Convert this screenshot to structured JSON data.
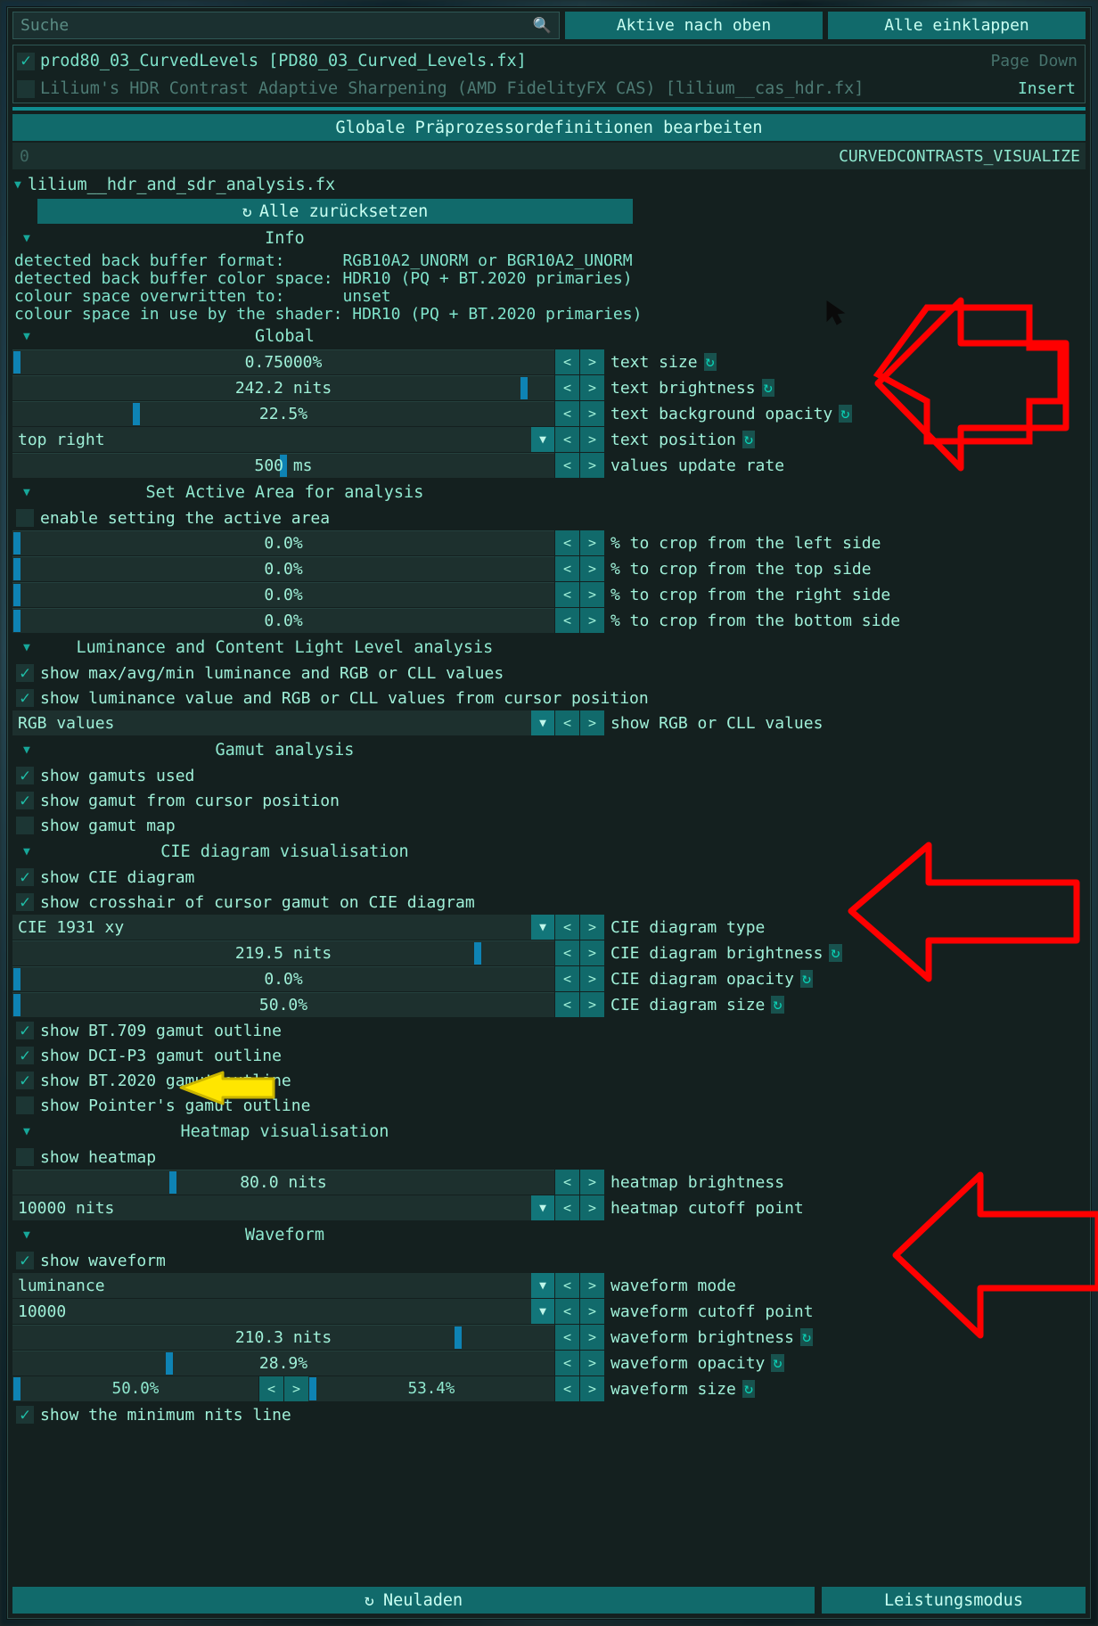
{
  "search": {
    "placeholder": "Suche",
    "icon": "search-icon"
  },
  "toolbar": {
    "active_top_label": "Aktive nach oben",
    "collapse_all_label": "Alle einklappen"
  },
  "techniques": [
    {
      "label": "prod80_03_CurvedLevels [PD80_03_Curved_Levels.fx]",
      "checked": true,
      "hint": "Page Down"
    },
    {
      "label": "Lilium's HDR Contrast Adaptive Sharpening (AMD FidelityFX CAS) [lilium__cas_hdr.fx]",
      "checked": false,
      "hint": "Insert"
    }
  ],
  "global_preproc": {
    "button_label": "Globale Präprozessordefinitionen bearbeiten",
    "value": "0",
    "name": "CURVEDCONTRASTS_VISUALIZE"
  },
  "effect": {
    "name": "lilium__hdr_and_sdr_analysis.fx",
    "reset_all_label": "Alle zurücksetzen"
  },
  "sections": {
    "info": "Info",
    "global": "Global",
    "active_area": "Set Active Area for analysis",
    "luminance": "Luminance and Content Light Level analysis",
    "gamut": "Gamut analysis",
    "cie": "CIE diagram visualisation",
    "heatmap": "Heatmap visualisation",
    "waveform": "Waveform"
  },
  "info_lines": [
    "detected back buffer format:      RGB10A2_UNORM or BGR10A2_UNORM",
    "detected back buffer color space: HDR10 (PQ + BT.2020 primaries)",
    "colour space overwritten to:      unset",
    "colour space in use by the shader: HDR10 (PQ + BT.2020 primaries)"
  ],
  "controls": {
    "text_size": {
      "value": "0.75000%",
      "label": "text size",
      "fill": 0.4,
      "reset": true
    },
    "text_brightness": {
      "value": "242.2 nits",
      "label": "text brightness",
      "fill": 94.5,
      "reset": true
    },
    "text_background_opacity": {
      "value": "22.5%",
      "label": "text background opacity",
      "fill": 22.5,
      "reset": true
    },
    "text_position": {
      "value": "top right",
      "label": "text position",
      "reset": true
    },
    "values_update_rate": {
      "value": "500 ms",
      "label": "values update rate",
      "fill": 49.0,
      "reset": false
    },
    "enable_active_area": {
      "label": "enable setting the active area",
      "checked": false
    },
    "crop_left": {
      "value": "0.0%",
      "label": "% to crop from the left side",
      "fill": 0
    },
    "crop_top": {
      "value": "0.0%",
      "label": "% to crop from the top side",
      "fill": 0
    },
    "crop_right": {
      "value": "0.0%",
      "label": "% to crop from the right side",
      "fill": 0
    },
    "crop_bottom": {
      "value": "0.0%",
      "label": "% to crop from the bottom side",
      "fill": 0
    },
    "show_maxavgmin": {
      "label": "show max/avg/min luminance and RGB or CLL values",
      "checked": true
    },
    "show_cursor_lum": {
      "label": "show luminance value and RGB or CLL values from cursor position",
      "checked": true
    },
    "rgb_or_cll": {
      "value": "RGB values",
      "label": "show RGB or CLL values"
    },
    "show_gamuts_used": {
      "label": "show gamuts used",
      "checked": true
    },
    "show_gamut_cursor": {
      "label": "show gamut from cursor position",
      "checked": true
    },
    "show_gamut_map": {
      "label": "show gamut map",
      "checked": false
    },
    "show_cie": {
      "label": "show CIE diagram",
      "checked": true
    },
    "show_cie_crosshair": {
      "label": "show crosshair of cursor gamut on CIE diagram",
      "checked": true
    },
    "cie_type": {
      "value": "CIE 1931 xy",
      "label": "CIE diagram type"
    },
    "cie_brightness": {
      "value": "219.5 nits",
      "label": "CIE diagram brightness",
      "fill": 86.0,
      "reset": true
    },
    "cie_opacity": {
      "value": "0.0%",
      "label": "CIE diagram opacity",
      "fill": 0,
      "reset": true
    },
    "cie_size": {
      "value": "50.0%",
      "label": "CIE diagram size",
      "fill": 0,
      "reset": true
    },
    "show_bt709": {
      "label": "show BT.709 gamut outline",
      "checked": true
    },
    "show_dcip3": {
      "label": "show DCI-P3 gamut outline",
      "checked": true
    },
    "show_bt2020": {
      "label": "show BT.2020 gamut outline",
      "checked": true
    },
    "show_pointers": {
      "label": "show Pointer's gamut outline",
      "checked": false
    },
    "show_heatmap": {
      "label": "show heatmap",
      "checked": false
    },
    "heatmap_brightness": {
      "value": "80.0 nits",
      "label": "heatmap brightness",
      "fill": 29.5
    },
    "heatmap_cutoff": {
      "value": "10000 nits",
      "label": "heatmap cutoff point"
    },
    "show_waveform": {
      "label": "show waveform",
      "checked": true
    },
    "waveform_mode": {
      "value": "luminance",
      "label": "waveform mode"
    },
    "waveform_cutoff": {
      "value": "10000",
      "label": "waveform cutoff point"
    },
    "waveform_brightness": {
      "value": "210.3 nits",
      "label": "waveform brightness",
      "fill": 82.5,
      "reset": true
    },
    "waveform_opacity": {
      "value": "28.9%",
      "label": "waveform opacity",
      "fill": 28.9,
      "reset": true
    },
    "waveform_size_a": {
      "value": "50.0%",
      "fill": 0
    },
    "waveform_size_b": {
      "value": "53.4%",
      "fill": 0
    },
    "waveform_size_label": {
      "label": "waveform size",
      "reset": true
    },
    "show_min_nits_line": {
      "label": "show the minimum nits line",
      "checked": true
    }
  },
  "footer": {
    "reload_label": "Neuladen",
    "reload_icon": "refresh-icon",
    "performance_label": "Leistungsmodus"
  },
  "annotations": [
    {
      "name": "red-arrow-text-controls",
      "color": "#ff0000",
      "direction": "left"
    },
    {
      "name": "red-arrow-cie-controls",
      "color": "#ff0000",
      "direction": "left"
    },
    {
      "name": "red-arrow-waveform-controls",
      "color": "#ff0000",
      "direction": "left"
    },
    {
      "name": "yellow-arrow-show-heatmap",
      "color": "#ffe600",
      "direction": "left"
    }
  ],
  "colors": {
    "accent": "#116a6b",
    "text": "#9ff0d8",
    "slider_grab": "#0e83b4",
    "window_bg": "#14201f",
    "red_annotation": "#ff0000",
    "yellow_annotation": "#ffe600"
  }
}
